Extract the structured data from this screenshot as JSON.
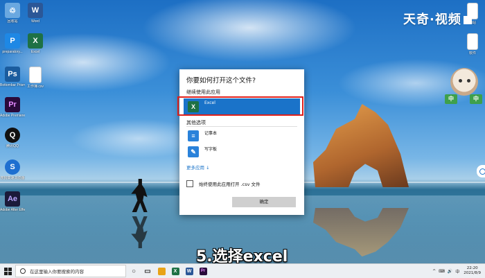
{
  "desktop": {
    "icons_left": [
      {
        "label": "回收站",
        "glyph": "♲",
        "color": "#6aa8e0"
      },
      {
        "label": "Word",
        "glyph": "W",
        "color": "#2b5797"
      },
      {
        "label": "preparatory...",
        "glyph": "P",
        "color": "#1e88e5"
      },
      {
        "label": "Excel",
        "glyph": "X",
        "color": "#1e7145"
      },
      {
        "label": "Bottombar Prisma...",
        "glyph": "Ps",
        "color": "#1b5c9e"
      },
      {
        "label": "工作簿.csv",
        "glyph": "",
        "color": "#ffffff"
      },
      {
        "label": "Adobe Premiere Pro",
        "glyph": "Pr",
        "color": "#2a0a3a"
      },
      {
        "label": "腾讯QQ",
        "glyph": "Q",
        "color": "#111111"
      },
      {
        "label": "搜狗高速浏览器",
        "glyph": "S",
        "color": "#1e6fd0"
      },
      {
        "label": "Adobe After Effects 2020",
        "glyph": "Ae",
        "color": "#1b1a3a"
      }
    ],
    "icons_right": [
      {
        "label": "网站",
        "glyph": "",
        "color": "#ffffff"
      },
      {
        "label": "软件",
        "glyph": "",
        "color": "#ffffff"
      }
    ],
    "brand": "天奇·视频"
  },
  "dialog": {
    "title": "你要如何打开这个文件?",
    "continue_section": "继续使用此应用",
    "selected_app": {
      "name": "Excel",
      "glyph": "X",
      "color": "#1e7145"
    },
    "other_section": "其他选项",
    "other_apps": [
      {
        "name": "记事本",
        "glyph": "≡",
        "color": "#2a82da"
      },
      {
        "name": "写字板",
        "glyph": "✎",
        "color": "#2a82da"
      }
    ],
    "more_apps": "更多应用 ↓",
    "always_use": "始终使用此应用打开 .csv 文件",
    "ok_button": "确定",
    "highlight_color": "#e0201a"
  },
  "caption": "5.选择excel",
  "taskbar": {
    "search_placeholder": "在这里输入你要搜索的内容",
    "apps": [
      {
        "name": "cortana",
        "glyph": "○",
        "color": "#333333"
      },
      {
        "name": "task-view",
        "glyph": "▭",
        "color": "#333333"
      },
      {
        "name": "file-explorer",
        "glyph": "▬",
        "color": "#e8a317"
      },
      {
        "name": "excel",
        "glyph": "X",
        "color": "#1e7145"
      },
      {
        "name": "word",
        "glyph": "W",
        "color": "#2b5797"
      },
      {
        "name": "premiere",
        "glyph": "Pr",
        "color": "#2a0a3a"
      }
    ],
    "tray": [
      "^",
      "⌨",
      "🔊",
      "中"
    ],
    "time": "22:20",
    "date": "2021/8/9"
  }
}
